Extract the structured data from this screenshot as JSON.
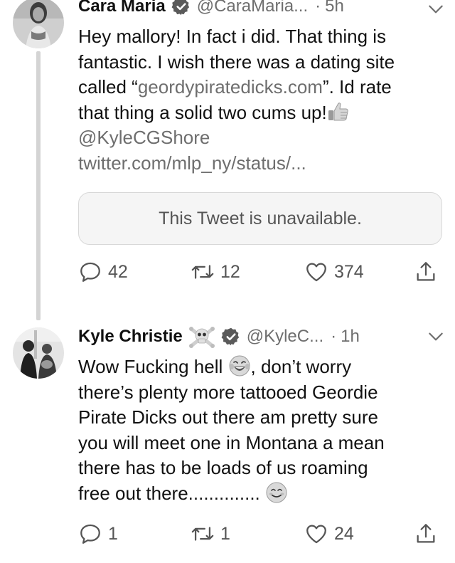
{
  "tweets": [
    {
      "author": {
        "name": "Cara Maria",
        "handle": "@CaraMaria...",
        "verified": true,
        "avatar": "avatar-cara-maria"
      },
      "separator": "·",
      "time": "5h",
      "text_lines": [
        "Hey mallory! In fact i did. That thing is",
        "fantastic. I wish there was a dating site",
        "called “",
        "geordypiratedicks.com",
        "”. Id rate",
        "that thing a solid two cums up!",
        "@KyleCGShore",
        "twitter.com/mlp_ny/status/..."
      ],
      "emoji": "thumbs-up",
      "quote_text": "This Tweet is unavailable.",
      "stats": {
        "replies": "42",
        "retweets": "12",
        "likes": "374"
      }
    },
    {
      "author": {
        "name": "Kyle Christie",
        "handle": "@KyleC...",
        "verified": true,
        "name_emoji": "skull-crossbones",
        "avatar": "avatar-kyle-christie"
      },
      "separator": "·",
      "time": "1h",
      "text_parts": {
        "a": "Wow Fucking hell ",
        "b": ", don’t worry",
        "c": "there’s plenty more tattooed Geordie",
        "d": "Pirate Dicks out there am pretty sure",
        "e": "you will meet one in Montana a mean",
        "f": "there has to be loads of us roaming",
        "g": "free out there.............. "
      },
      "emojis": [
        "laughing-tears",
        "smiling-face"
      ],
      "stats": {
        "replies": "1",
        "retweets": "1",
        "likes": "24"
      }
    }
  ],
  "icons": {
    "reply": "reply-icon",
    "retweet": "retweet-icon",
    "like": "heart-icon",
    "share": "share-icon",
    "more": "chevron-down-icon",
    "verified": "verified-badge-icon"
  },
  "colors": {
    "text": "#111111",
    "muted": "#6e6e6e",
    "line": "#d4d4d4"
  }
}
